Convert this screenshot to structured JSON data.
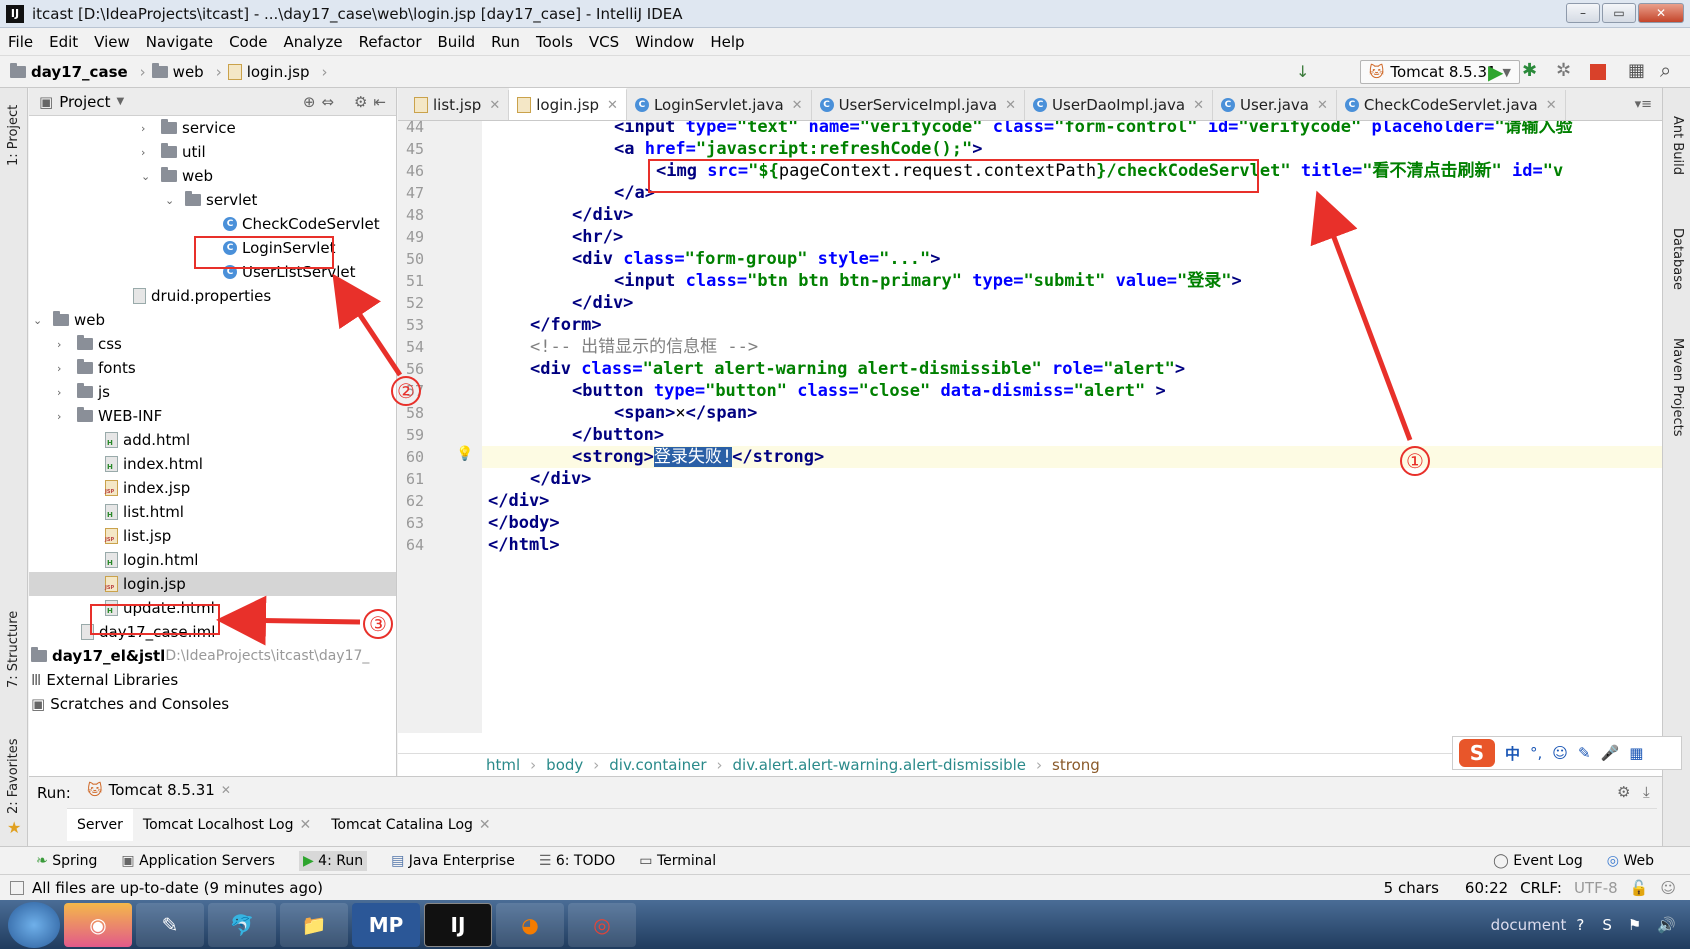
{
  "window": {
    "title": "itcast [D:\\IdeaProjects\\itcast] - ...\\day17_case\\web\\login.jsp [day17_case] - IntelliJ IDEA",
    "app_icon": "IJ",
    "buttons": [
      "–",
      "▭",
      "✕"
    ]
  },
  "menu": [
    "File",
    "Edit",
    "View",
    "Navigate",
    "Code",
    "Analyze",
    "Refactor",
    "Build",
    "Run",
    "Tools",
    "VCS",
    "Window",
    "Help"
  ],
  "nav": {
    "crumbs": [
      "day17_case",
      "web",
      "login.jsp"
    ],
    "run_config": "Tomcat 8.5.31"
  },
  "left_strip": {
    "project": "1: Project",
    "structure": "7: Structure",
    "favorites": "2: Favorites"
  },
  "right_strip": {
    "ant": "Ant Build",
    "database": "Database",
    "maven": "Maven Projects"
  },
  "project_pane": {
    "header": "Project",
    "tree": [
      {
        "label": "service",
        "kind": "folder"
      },
      {
        "label": "util",
        "kind": "folder"
      },
      {
        "label": "web",
        "kind": "folder"
      },
      {
        "label": "servlet",
        "kind": "folder"
      },
      {
        "label": "CheckCodeServlet",
        "kind": "class"
      },
      {
        "label": "LoginServlet",
        "kind": "class"
      },
      {
        "label": "UserListServlet",
        "kind": "class"
      },
      {
        "label": "druid.properties",
        "kind": "file"
      },
      {
        "label": "web",
        "kind": "folder"
      },
      {
        "label": "css",
        "kind": "folder"
      },
      {
        "label": "fonts",
        "kind": "folder"
      },
      {
        "label": "js",
        "kind": "folder"
      },
      {
        "label": "WEB-INF",
        "kind": "folder"
      },
      {
        "label": "add.html",
        "kind": "html"
      },
      {
        "label": "index.html",
        "kind": "html"
      },
      {
        "label": "index.jsp",
        "kind": "jsp"
      },
      {
        "label": "list.html",
        "kind": "html"
      },
      {
        "label": "list.jsp",
        "kind": "jsp"
      },
      {
        "label": "login.html",
        "kind": "html"
      },
      {
        "label": "login.jsp",
        "kind": "jsp"
      },
      {
        "label": "update.html",
        "kind": "html"
      },
      {
        "label": "day17_case.iml",
        "kind": "file"
      },
      {
        "label": "day17_el&jstl",
        "kind": "module",
        "path": "D:\\IdeaProjects\\itcast\\day17_"
      },
      {
        "label": "External Libraries",
        "kind": "lib"
      },
      {
        "label": "Scratches and Consoles",
        "kind": "scratch"
      }
    ]
  },
  "tabs": [
    "list.jsp",
    "login.jsp",
    "LoginServlet.java",
    "UserServiceImpl.java",
    "UserDaoImpl.java",
    "User.java",
    "CheckCodeServlet.java"
  ],
  "active_tab": "login.jsp",
  "code": {
    "line_numbers": [
      "44",
      "45",
      "46",
      "47",
      "48",
      "49",
      "50",
      "51",
      "52",
      "53",
      "54",
      "56",
      "57",
      "58",
      "59",
      "60",
      "61",
      "62",
      "63",
      "64"
    ],
    "lines": [
      [
        [
          "tg",
          "<input "
        ],
        [
          "at",
          "type="
        ],
        [
          "st",
          "\"text\" "
        ],
        [
          "at",
          "name="
        ],
        [
          "st",
          "\"verifycode\" "
        ],
        [
          "at",
          "class="
        ],
        [
          "st",
          "\"form-control\" "
        ],
        [
          "at",
          "id="
        ],
        [
          "st",
          "\"verifycode\" "
        ],
        [
          "at",
          "placeholder="
        ],
        [
          "st",
          "\"请输入验"
        ]
      ],
      [
        [
          "tg",
          "<a "
        ],
        [
          "at",
          "href="
        ],
        [
          "st",
          "\"javascript:refreshCode();\""
        ],
        [
          "tg",
          ">"
        ]
      ],
      [
        [
          "tg",
          "<img "
        ],
        [
          "at",
          "src="
        ],
        [
          "st",
          "\"${"
        ],
        [
          "",
          "pageContext.request.contextPath"
        ],
        [
          "st",
          "}/checkCodeServlet\" "
        ],
        [
          "at",
          "title="
        ],
        [
          "st",
          "\"看不清点击刷新\" "
        ],
        [
          "at",
          "id="
        ],
        [
          "st",
          "\"v"
        ]
      ],
      [
        [
          "tg",
          "</a>"
        ]
      ],
      [
        [
          "tg",
          "</div>"
        ]
      ],
      [
        [
          "tg",
          "<hr/>"
        ]
      ],
      [
        [
          "tg",
          "<div "
        ],
        [
          "at",
          "class="
        ],
        [
          "st",
          "\"form-group\" "
        ],
        [
          "at",
          "style="
        ],
        [
          "st",
          "\"...\""
        ],
        [
          "tg",
          ">"
        ]
      ],
      [
        [
          "tg",
          "<input "
        ],
        [
          "at",
          "class="
        ],
        [
          "st",
          "\"btn btn btn-primary\" "
        ],
        [
          "at",
          "type="
        ],
        [
          "st",
          "\"submit\" "
        ],
        [
          "at",
          "value="
        ],
        [
          "st",
          "\"登录\""
        ],
        [
          "tg",
          ">"
        ]
      ],
      [
        [
          "tg",
          "</div>"
        ]
      ],
      [
        [
          "tg",
          "</form>"
        ]
      ],
      [
        [
          "cm",
          "<!-- 出错显示的信息框 -->"
        ]
      ],
      [
        [
          "tg",
          "<div "
        ],
        [
          "at",
          "class="
        ],
        [
          "st",
          "\"alert alert-warning alert-dismissible\" "
        ],
        [
          "at",
          "role="
        ],
        [
          "st",
          "\"alert\""
        ],
        [
          "tg",
          ">"
        ]
      ],
      [
        [
          "tg",
          "<button "
        ],
        [
          "at",
          "type="
        ],
        [
          "st",
          "\"button\" "
        ],
        [
          "at",
          "class="
        ],
        [
          "st",
          "\"close\" "
        ],
        [
          "at",
          "data-dismiss="
        ],
        [
          "st",
          "\"alert\" "
        ],
        [
          "tg",
          ">"
        ]
      ],
      [
        [
          "tg",
          "<span>"
        ],
        [
          "",
          "×"
        ],
        [
          "tg",
          "</span>"
        ]
      ],
      [
        [
          "tg",
          "</button>"
        ]
      ],
      [
        [
          "tg",
          "<strong>"
        ],
        [
          "sel",
          "登录失败!"
        ],
        [
          "tg",
          "</strong>"
        ]
      ],
      [
        [
          "tg",
          "</div>"
        ]
      ],
      [
        [
          "tg",
          "</div>"
        ]
      ],
      [
        [
          "tg",
          "</body>"
        ]
      ],
      [
        [
          "tg",
          "</html>"
        ]
      ]
    ],
    "indents": [
      3,
      3,
      4,
      3,
      2,
      2,
      2,
      3,
      2,
      1,
      1,
      1,
      2,
      3,
      2,
      2,
      1,
      0,
      0,
      0
    ]
  },
  "breadcrumbs": [
    "html",
    "body",
    "div.container",
    "div.alert.alert-warning.alert-dismissible",
    "strong"
  ],
  "run": {
    "label": "Run:",
    "config": "Tomcat 8.5.31",
    "tabs": [
      "Server",
      "Tomcat Localhost Log",
      "Tomcat Catalina Log"
    ]
  },
  "tool_windows": [
    "Spring",
    "Application Servers",
    "4: Run",
    "Java Enterprise",
    "6: TODO",
    "Terminal",
    "Event Log",
    "Web"
  ],
  "status": {
    "message": "All files are up-to-date (9 minutes ago)",
    "chars": "5 chars",
    "position": "60:22",
    "line_sep": "CRLF:",
    "encoding": "UTF-8"
  },
  "ime": {
    "lang": "中"
  },
  "taskbar": {
    "tray_text": "document",
    "apps": [
      "MP",
      "IJ"
    ]
  },
  "annotations": [
    "①",
    "②",
    "③"
  ],
  "colors": {
    "accent_red": "#e8302a",
    "tag": "#000080",
    "attr": "#0000ff",
    "string": "#008000"
  }
}
